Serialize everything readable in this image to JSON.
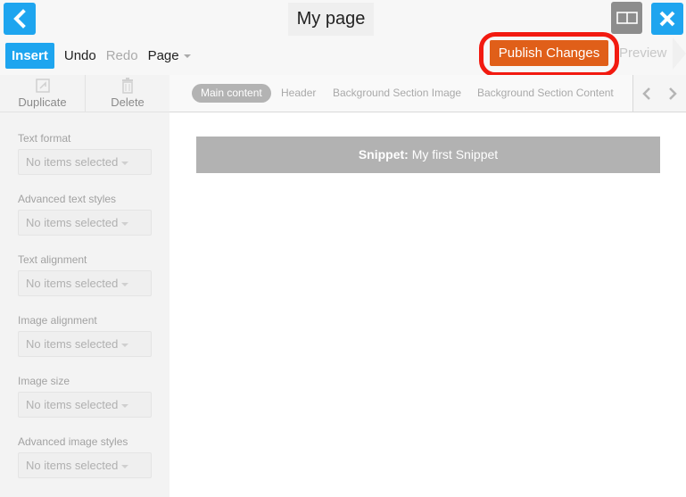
{
  "header": {
    "title": "My page",
    "back_icon": "chevron-left-icon",
    "layout_icon": "layout-split-icon",
    "close_icon": "close-icon"
  },
  "menu": {
    "insert": "Insert",
    "undo": "Undo",
    "redo": "Redo",
    "page": "Page",
    "publish": "Publish Changes",
    "preview": "Preview"
  },
  "sidebar": {
    "tools": [
      {
        "label": "Duplicate",
        "icon": "duplicate-icon"
      },
      {
        "label": "Delete",
        "icon": "trash-icon"
      }
    ],
    "groups": [
      {
        "label": "Text format",
        "value": "No items selected"
      },
      {
        "label": "Advanced text styles",
        "value": "No items selected"
      },
      {
        "label": "Text alignment",
        "value": "No items selected"
      },
      {
        "label": "Image alignment",
        "value": "No items selected"
      },
      {
        "label": "Image size",
        "value": "No items selected"
      },
      {
        "label": "Advanced image styles",
        "value": "No items selected"
      }
    ]
  },
  "tabs": [
    "Main content",
    "Header",
    "Background Section Image",
    "Background Section Content"
  ],
  "snippet": {
    "prefix": "Snippet:",
    "name": "My first Snippet"
  },
  "colors": {
    "accent": "#1ea5ef",
    "publish": "#e05f19",
    "highlight": "#f21a10"
  }
}
